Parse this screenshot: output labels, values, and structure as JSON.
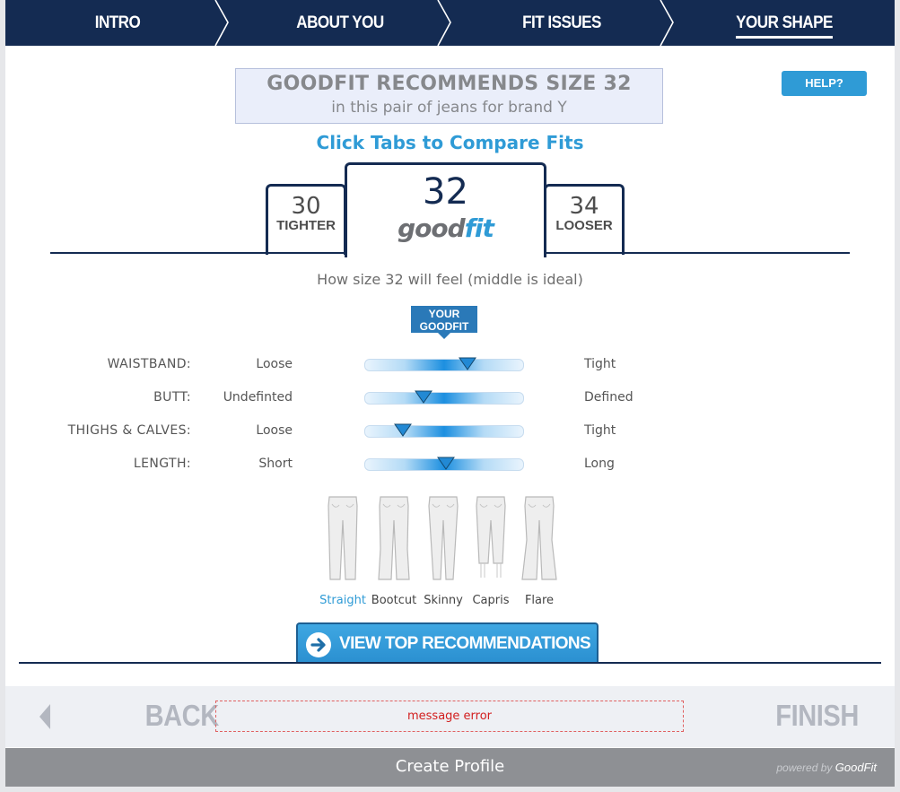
{
  "nav": {
    "steps": [
      {
        "label": "INTRO"
      },
      {
        "label": "ABOUT YOU"
      },
      {
        "label": "FIT ISSUES"
      },
      {
        "label": "YOUR SHAPE"
      }
    ],
    "active_step": "YOUR SHAPE"
  },
  "recommendation": {
    "title": "GOODFIT RECOMMENDS SIZE 32",
    "subtitle": "in this pair of jeans for brand Y"
  },
  "help_label": "HELP?",
  "compare_title": "Click Tabs to Compare Fits",
  "tabs": {
    "left": {
      "size": "30",
      "label": "TIGHTER"
    },
    "center": {
      "size": "32",
      "logo_text_main": "good",
      "logo_text_accent": "fit"
    },
    "right": {
      "size": "34",
      "label": "LOOSER"
    }
  },
  "feel_caption": "How size 32 will feel (middle is ideal)",
  "your_goodfit_label_line1": "YOUR",
  "your_goodfit_label_line2": "GOODFIT",
  "fit_rows": [
    {
      "label": "WAISTBAND:",
      "left": "Loose",
      "right": "Tight",
      "level": 0.65
    },
    {
      "label": "BUTT:",
      "left": "Undefinted",
      "right": "Defined",
      "level": 0.37
    },
    {
      "label": "THIGHS & CALVES:",
      "left": "Loose",
      "right": "Tight",
      "level": 0.24
    },
    {
      "label": "LENGTH:",
      "left": "Short",
      "right": "Long",
      "level": 0.51
    }
  ],
  "styles": [
    {
      "name": "Straight",
      "selected": true
    },
    {
      "name": "Bootcut",
      "selected": false
    },
    {
      "name": "Skinny",
      "selected": false
    },
    {
      "name": "Capris",
      "selected": false
    },
    {
      "name": "Flare",
      "selected": false
    }
  ],
  "view_button_label": "VIEW TOP RECOMMENDATIONS",
  "footer": {
    "back_label": "BACK",
    "finish_label": "FINISH",
    "message": "message error"
  },
  "bottom": {
    "create_profile": "Create Profile",
    "powered_prefix": "powered by",
    "powered_brand": "GoodFit"
  },
  "colors": {
    "navy": "#142b52",
    "accent_blue": "#2f9bd6",
    "error_red": "#d21e1e"
  },
  "icons": [
    "chevron-right-icon",
    "arrow-right-circle-icon",
    "back-arrow-icon",
    "jeans-icon"
  ]
}
